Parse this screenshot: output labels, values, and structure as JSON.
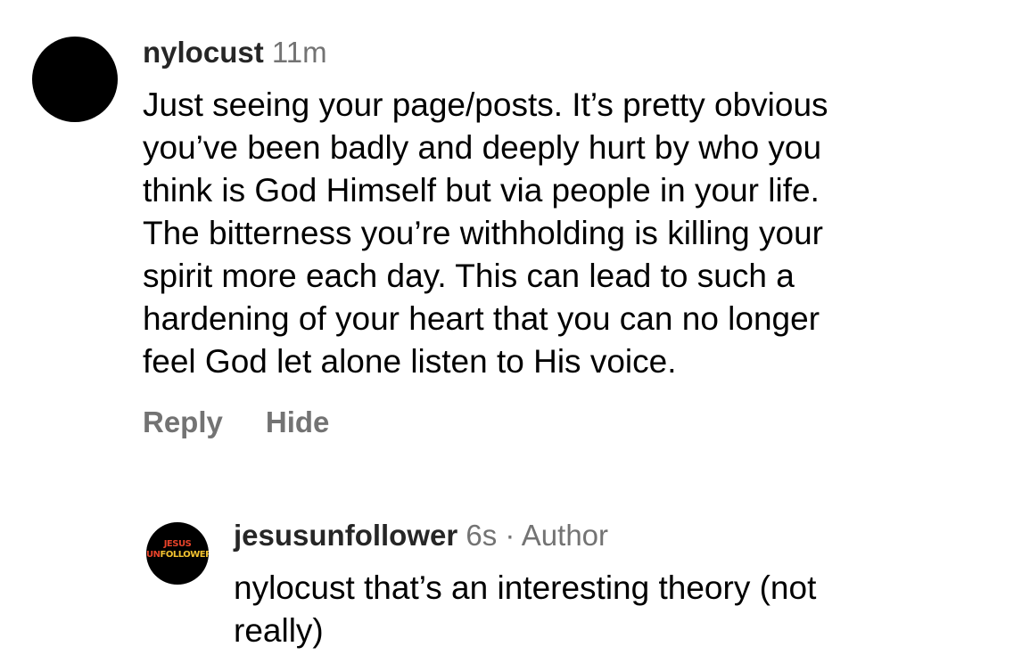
{
  "comment": {
    "username": "nylocust",
    "time": "11m",
    "lines": [
      "Just seeing your page/posts. It’s pretty obvious",
      "you’ve been badly and deeply hurt by who you",
      "think is God Himself but via people in your life.",
      "The bitterness you’re withholding is killing your",
      "spirit more each day. This can lead to such a",
      "hardening of your heart that you can no longer",
      "feel God let alone listen to His voice."
    ],
    "reply_label": "Reply",
    "hide_label": "Hide"
  },
  "reply": {
    "username": "jesusunfollower",
    "time": "6s",
    "separator": "·",
    "role": "Author",
    "avatar_line1": "JESUS",
    "avatar_un": "UN",
    "avatar_rest": "FOLLOWER",
    "lines": [
      "nylocust that’s an interesting theory (not",
      "really)"
    ]
  },
  "colors": {
    "text": "#000000",
    "username": "#262626",
    "secondary": "#737373",
    "avatar_bg": "#000000",
    "avatar_red": "#e8432a",
    "avatar_yellow": "#f2c230"
  }
}
